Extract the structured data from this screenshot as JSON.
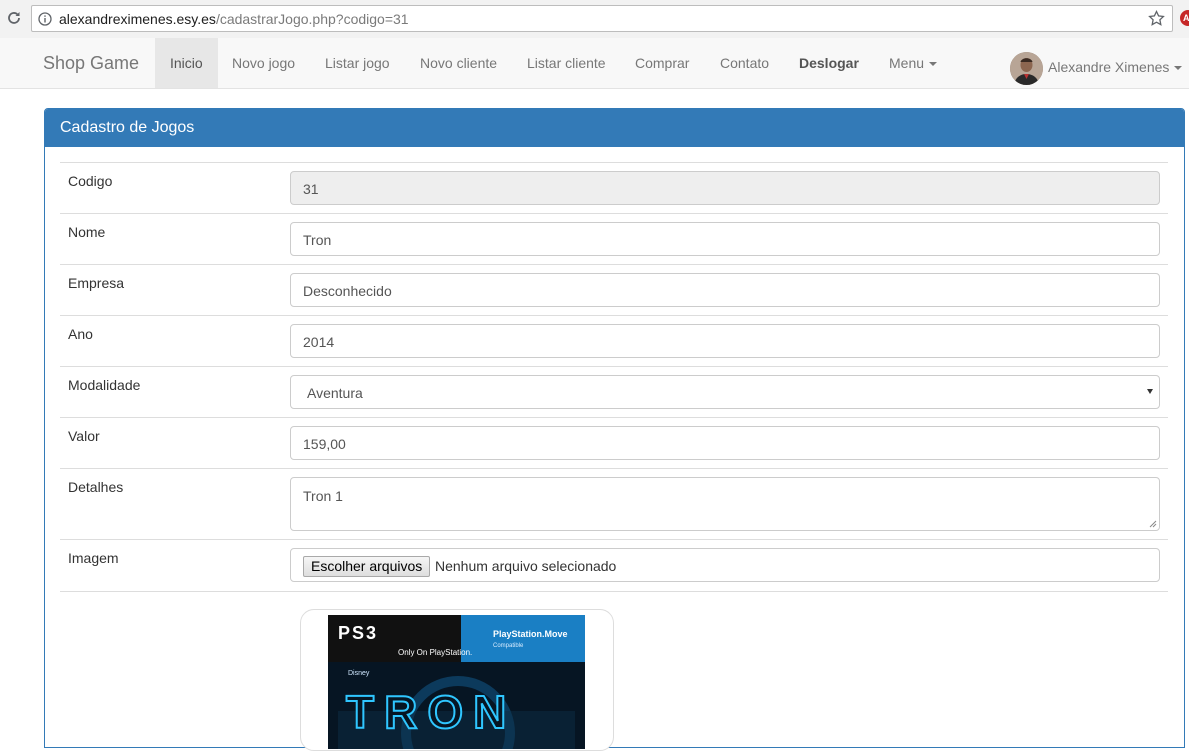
{
  "browser": {
    "url_domain": "alexandreximenes.esy.es",
    "url_path": "/cadastrarJogo.php?codigo=31"
  },
  "navbar": {
    "brand": "Shop Game",
    "items": [
      {
        "label": "Inicio"
      },
      {
        "label": "Novo jogo"
      },
      {
        "label": "Listar jogo"
      },
      {
        "label": "Novo cliente"
      },
      {
        "label": "Listar cliente"
      },
      {
        "label": "Comprar"
      },
      {
        "label": "Contato"
      },
      {
        "label": "Deslogar"
      },
      {
        "label": "Menu"
      }
    ],
    "user_name": "Alexandre Ximenes"
  },
  "panel": {
    "title": "Cadastro de Jogos",
    "fields": {
      "codigo": {
        "label": "Codigo",
        "value": "31"
      },
      "nome": {
        "label": "Nome",
        "value": "Tron"
      },
      "empresa": {
        "label": "Empresa",
        "value": "Desconhecido"
      },
      "ano": {
        "label": "Ano",
        "value": "2014"
      },
      "modalidade": {
        "label": "Modalidade",
        "value": "Aventura"
      },
      "valor": {
        "label": "Valor",
        "value": "159,00"
      },
      "detalhes": {
        "label": "Detalhes",
        "value": "Tron 1"
      },
      "imagem": {
        "label": "Imagem",
        "button": "Escolher arquivos",
        "status": "Nenhum arquivo selecionado"
      }
    },
    "cover": {
      "platform": "PS3",
      "exclusive": "Only On PlayStation.",
      "move": "PlayStation.Move",
      "move_sub": "Compatible",
      "publisher": "Disney",
      "game_title": "TRON"
    }
  },
  "colors": {
    "primary": "#337ab7",
    "navbar_bg": "#f8f8f8",
    "readonly_bg": "#eeeeee"
  }
}
